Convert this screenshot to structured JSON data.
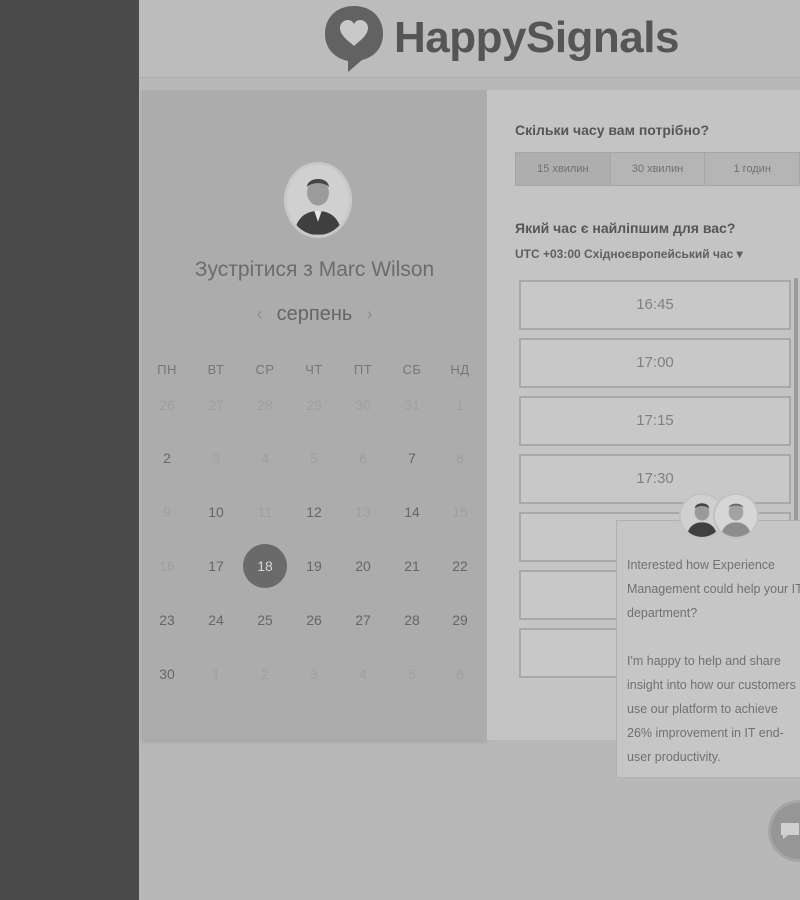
{
  "brand": {
    "name": "HappySignals",
    "logo_icon": "heart-speech-bubble-icon"
  },
  "calendar": {
    "title": "Зустрітися з Marc Wilson",
    "month": "серпень",
    "prev_icon": "chevron-left-icon",
    "next_icon": "chevron-right-icon",
    "weekdays": [
      "ПН",
      "ВТ",
      "СР",
      "ЧТ",
      "ПТ",
      "СБ",
      "НД"
    ],
    "weeks": [
      [
        "26",
        "27",
        "28",
        "29",
        "30",
        "31",
        "1"
      ],
      [
        "2",
        "3",
        "4",
        "5",
        "6",
        "7",
        "8"
      ],
      [
        "9",
        "10",
        "11",
        "12",
        "13",
        "14",
        "15"
      ],
      [
        "16",
        "17",
        "18",
        "19",
        "20",
        "21",
        "22"
      ],
      [
        "23",
        "24",
        "25",
        "26",
        "27",
        "28",
        "29"
      ],
      [
        "30",
        "1",
        "2",
        "3",
        "4",
        "5",
        "6"
      ]
    ],
    "selected_day": "18"
  },
  "duration": {
    "question": "Скільки часу вам потрібно?",
    "options": [
      "15 хвилин",
      "30 хвилин",
      "1 годин"
    ],
    "selected": "15 хвилин"
  },
  "time": {
    "question": "Який час є найліпшим для вас?",
    "timezone": "UTC +03:00 Східноєвропейський час ▾",
    "slots": [
      "16:45",
      "17:00",
      "17:15",
      "17:30"
    ]
  },
  "chat": {
    "paragraph1": "Interested how Experience Management could help your IT department?",
    "paragraph2": "I'm happy to help and share insight into how our customers use our platform to achieve 26% improvement in IT end-user productivity.",
    "fab_icon": "chat-bubble-icon"
  },
  "colors": {
    "selected_day_bg": "#6a6a6a",
    "left_strip": "#4b4b4b"
  }
}
